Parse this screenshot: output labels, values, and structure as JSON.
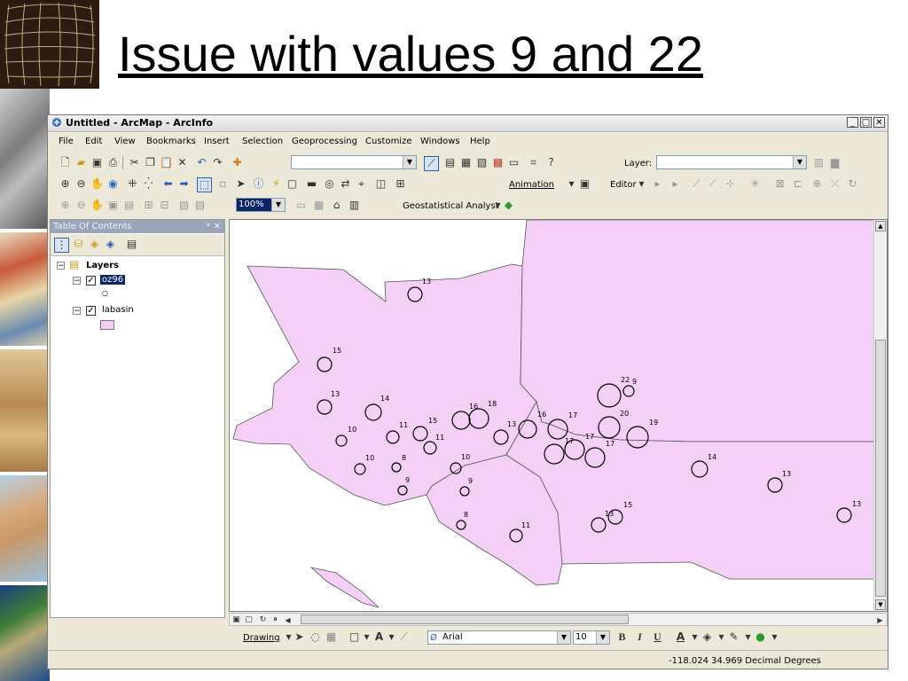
{
  "slide": {
    "title": "Issue with values 9 and 22"
  },
  "window": {
    "title": "Untitled - ArcMap - ArcInfo",
    "controls": {
      "minimize": "_",
      "maximize": "□",
      "close": "✕"
    }
  },
  "menu": [
    "File",
    "Edit",
    "View",
    "Bookmarks",
    "Insert",
    "Selection",
    "Geoprocessing",
    "Customize",
    "Windows",
    "Help"
  ],
  "toolbar": {
    "layer_label": "Layer:",
    "animation_label": "Animation",
    "editor_label": "Editor",
    "zoom_value": "100%",
    "geostat_label": "Geostatistical Analyst"
  },
  "toc": {
    "header": "Table Of Contents",
    "root": "Layers",
    "layers": [
      {
        "name": "oz96",
        "checked": true,
        "selected": true
      },
      {
        "name": "labasin",
        "checked": true,
        "selected": false
      }
    ]
  },
  "map": {
    "polygon_fill": "#f5d0f6",
    "points": [
      {
        "label": "13"
      },
      {
        "label": "15"
      },
      {
        "label": "13"
      },
      {
        "label": "14"
      },
      {
        "label": "10"
      },
      {
        "label": "11"
      },
      {
        "label": "15"
      },
      {
        "label": "11"
      },
      {
        "label": "10"
      },
      {
        "label": "8"
      },
      {
        "label": "9"
      },
      {
        "label": "16"
      },
      {
        "label": "18"
      },
      {
        "label": "10"
      },
      {
        "label": "9"
      },
      {
        "label": "8"
      },
      {
        "label": "13"
      },
      {
        "label": "16"
      },
      {
        "label": "17"
      },
      {
        "label": "22"
      },
      {
        "label": "9"
      },
      {
        "label": "20"
      },
      {
        "label": "19"
      },
      {
        "label": "17"
      },
      {
        "label": "17"
      },
      {
        "label": "17"
      },
      {
        "label": "14"
      },
      {
        "label": "13"
      },
      {
        "label": "11"
      },
      {
        "label": "13"
      },
      {
        "label": "15"
      },
      {
        "label": "13"
      }
    ]
  },
  "drawing": {
    "drawing_label": "Drawing",
    "font_name": "Arial",
    "font_size": "10",
    "bold": "B",
    "italic": "I",
    "underline": "U",
    "font_color_letter": "A"
  },
  "status": {
    "coordinates": "-118.024  34.969 Decimal Degrees"
  }
}
